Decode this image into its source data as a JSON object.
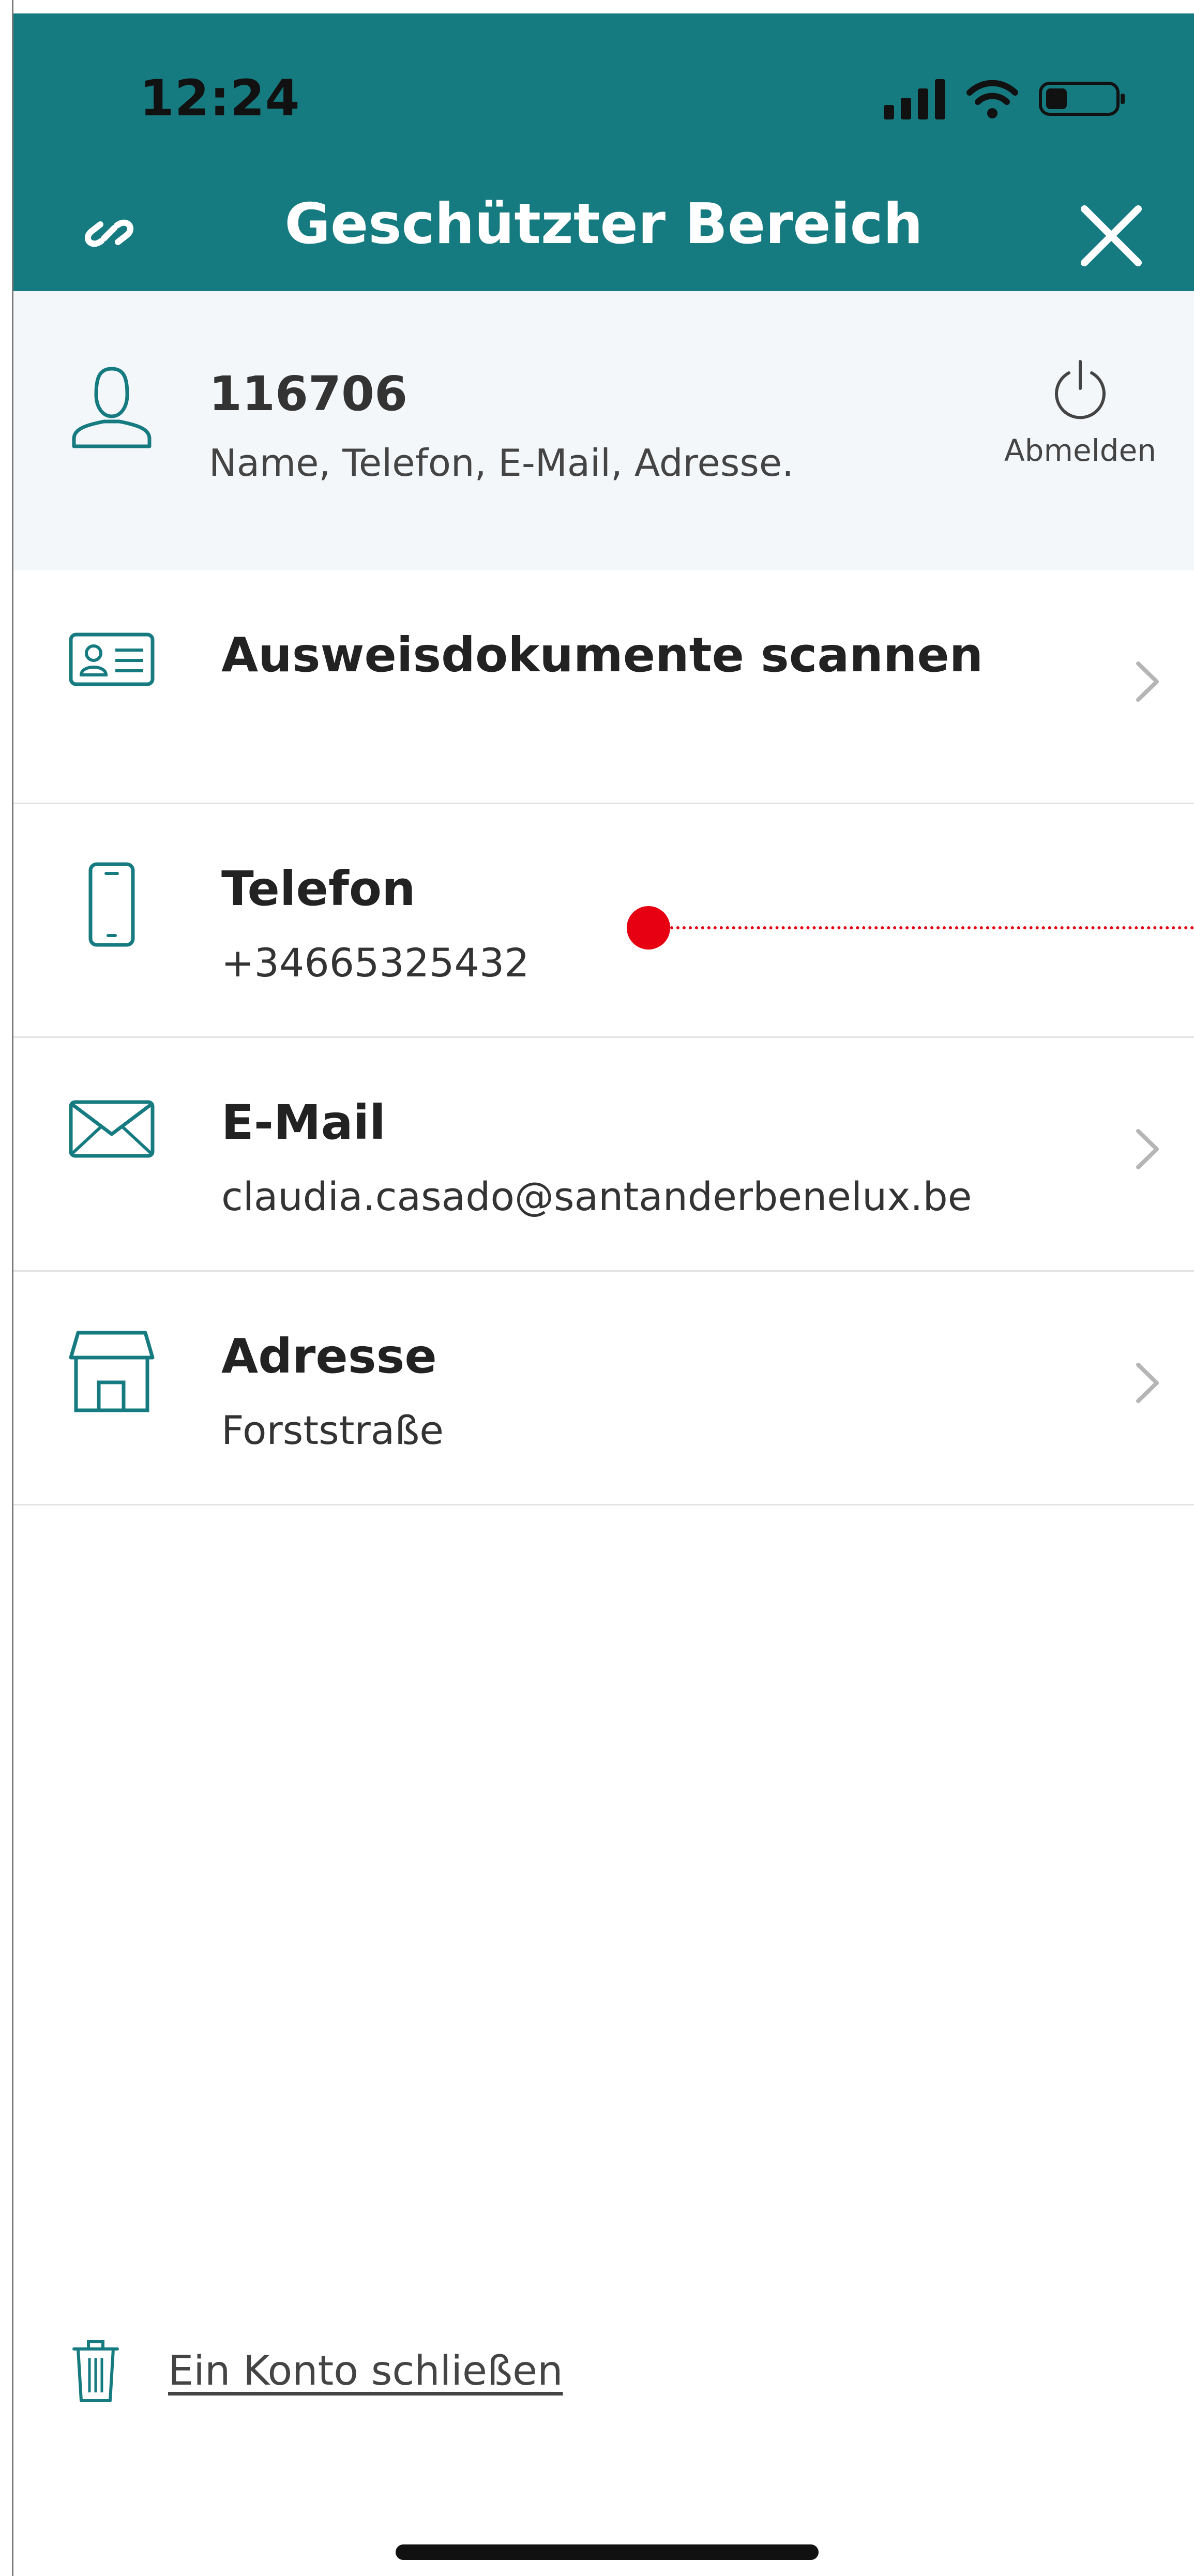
{
  "status_bar": {
    "time": "12:24"
  },
  "header": {
    "title": "Geschützter Bereich",
    "icons": {
      "left": "link-icon",
      "right": "close-icon"
    }
  },
  "account": {
    "number": "116706",
    "subtitle": "Name, Telefon, E-Mail, Adresse.",
    "logout_label": "Abmelden"
  },
  "rows": [
    {
      "icon": "id-card-icon",
      "title": "Ausweisdokumente scannen",
      "value": ""
    },
    {
      "icon": "smartphone-icon",
      "title": "Telefon",
      "value": "+34665325432"
    },
    {
      "icon": "envelope-icon",
      "title": "E-Mail",
      "value": "claudia.casado@santanderbenelux.be"
    },
    {
      "icon": "house-icon",
      "title": "Adresse",
      "value": "Forststraße"
    }
  ],
  "footer": {
    "close_account_label": "Ein Konto schließen",
    "icon": "trash-icon"
  },
  "colors": {
    "primary": "#167b80",
    "accent_dot": "#e60012",
    "panel_bg": "#f4f7fa"
  }
}
